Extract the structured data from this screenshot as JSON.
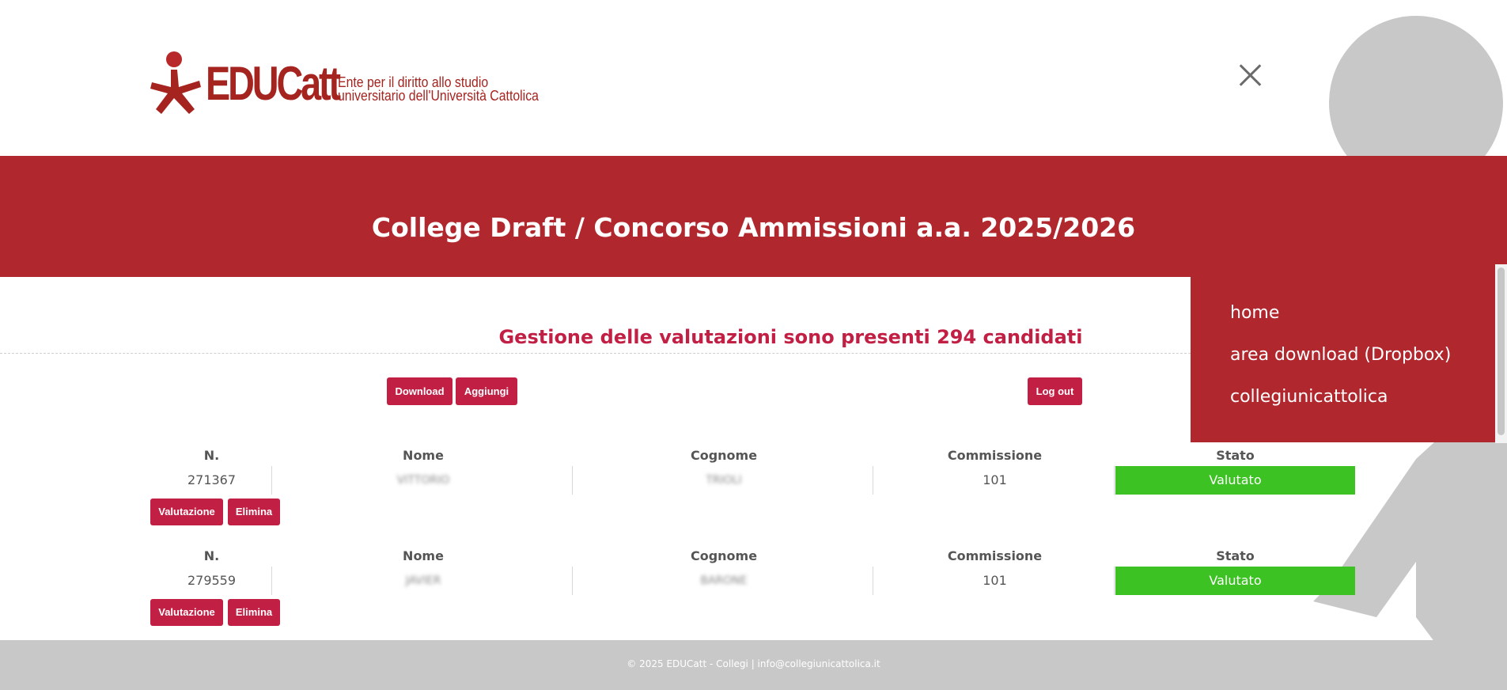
{
  "header": {
    "logo_text": "EDUCatt",
    "logo_sub_line1": "Ente per il diritto allo studio",
    "logo_sub_line2": "universitario dell'Università Cattolica",
    "close_icon": "close-icon"
  },
  "banner": {
    "title": "College Draft / Concorso Ammissioni a.a. 2025/2026"
  },
  "menu": {
    "items": [
      {
        "label": "home"
      },
      {
        "label": "area download (Dropbox)"
      },
      {
        "label": "collegiunicattolica"
      }
    ]
  },
  "main": {
    "title": "Gestione delle valutazioni sono presenti 294 candidati",
    "buttons": {
      "download": "Download",
      "aggiungi": "Aggiungi",
      "logout": "Log out"
    },
    "columns": [
      "N.",
      "Nome",
      "Cognome",
      "Commissione",
      "Stato"
    ],
    "rows": [
      {
        "n": "271367",
        "nome": "VITTORIO",
        "cognome": "TRIOLI",
        "commissione": "101",
        "stato": "Valutato",
        "btn_valutazione": "Valutazione",
        "btn_elimina": "Elimina"
      },
      {
        "n": "279559",
        "nome": "JAVIER",
        "cognome": "BARONE",
        "commissione": "101",
        "stato": "Valutato",
        "btn_valutazione": "Valutazione",
        "btn_elimina": "Elimina"
      }
    ]
  },
  "footer": {
    "text": "© 2025 EDUCatt - Collegi | info@collegiunicattolica.it"
  },
  "colors": {
    "brand_red": "#b0272e",
    "button_crimson": "#c21f45",
    "status_green": "#3cc222",
    "footer_grey": "#c8c8c8"
  }
}
